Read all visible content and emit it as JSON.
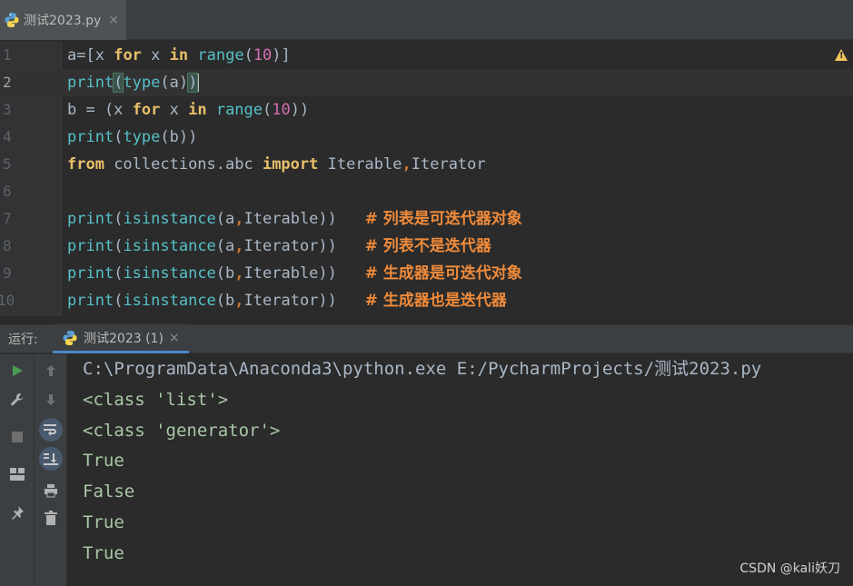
{
  "editor_tab": {
    "label": "测试2023.py",
    "close": "×",
    "icon": "python-file-icon"
  },
  "editor": {
    "line_numbers": [
      "1",
      "2",
      "3",
      "4",
      "5",
      "6",
      "7",
      "8",
      "9",
      "10"
    ],
    "current_line": 2,
    "warning_icon": "warning-triangle-icon"
  },
  "code": {
    "l1": {
      "a_eq": "a=[",
      "x1": "x ",
      "for": "for",
      "x2": " x ",
      "in": "in",
      "sp": " ",
      "range": "range",
      "lp": "(",
      "n": "10",
      "rp": ")",
      "end": "]"
    },
    "l2": {
      "print": "print",
      "lp": "(",
      "type": "type",
      "arg": "(a)",
      "rp": ")"
    },
    "l3": {
      "pre": "b = (x ",
      "for": "for",
      "x": " x ",
      "in": "in",
      "sp": " ",
      "range": "range",
      "lp": "(",
      "n": "10",
      "end": "))"
    },
    "l4": {
      "print": "print",
      "lp": "(",
      "type": "type",
      "arg": "(b))"
    },
    "l5": {
      "from": "from",
      "mod": " collections.abc ",
      "import": "import",
      "i1": " Iterable",
      "comma": ",",
      "i2": "Iterator"
    },
    "l7": {
      "print": "print",
      "lp": "(",
      "fn": "isinstance",
      "args1": "(a",
      "comma": ",",
      "args2": "Iterable))",
      "gap": "   ",
      "comment": "# 列表是可迭代器对象"
    },
    "l8": {
      "print": "print",
      "lp": "(",
      "fn": "isinstance",
      "args1": "(a",
      "comma": ",",
      "args2": "Iterator))",
      "gap": "   ",
      "comment": "# 列表不是迭代器"
    },
    "l9": {
      "print": "print",
      "lp": "(",
      "fn": "isinstance",
      "args1": "(b",
      "comma": ",",
      "args2": "Iterable))",
      "gap": "   ",
      "comment": "# 生成器是可迭代对象"
    },
    "l10": {
      "print": "print",
      "lp": "(",
      "fn": "isinstance",
      "args1": "(b",
      "comma": ",",
      "args2": "Iterator))",
      "gap": "   ",
      "comment": "# 生成器也是迭代器"
    }
  },
  "run_window": {
    "label": "运行:",
    "tab_label": "测试2023 (1)",
    "tab_close": "×",
    "toolbar_left": [
      "run-icon",
      "wrench-icon",
      "stop-icon",
      "layout-icon",
      "pin-icon"
    ],
    "toolbar_right": [
      "arrow-up-icon",
      "arrow-down-icon",
      "soft-wrap-icon",
      "scroll-to-end-icon",
      "print-icon",
      "trash-icon"
    ]
  },
  "console": {
    "lines": [
      "C:\\ProgramData\\Anaconda3\\python.exe E:/PycharmProjects/测试2023.py",
      "<class 'list'>",
      "<class 'generator'>",
      "True",
      "False",
      "True",
      "True"
    ]
  },
  "watermark": "CSDN @kali妖刀",
  "colors": {
    "background": "#2b2b2b",
    "keyword": "#cc7832",
    "builtin": "#56c0c8",
    "number": "#d46fb2",
    "comment": "#f08b3b"
  }
}
